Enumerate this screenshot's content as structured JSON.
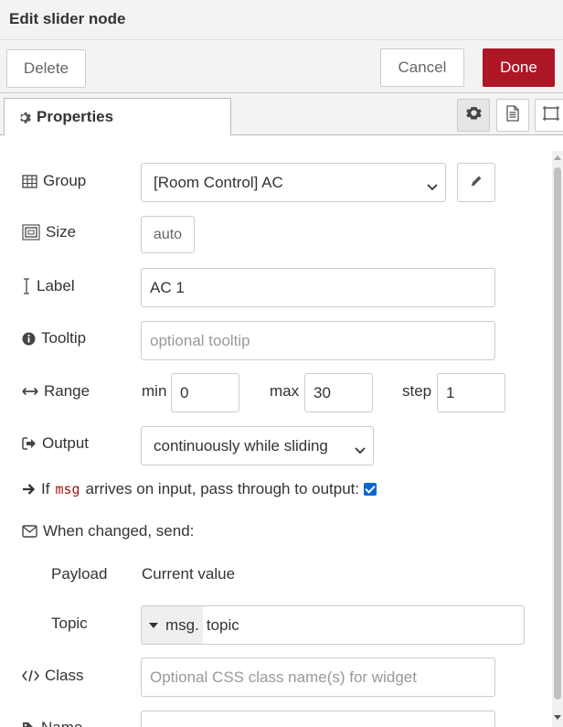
{
  "dialog": {
    "title": "Edit slider node"
  },
  "toolbar": {
    "delete_label": "Delete",
    "cancel_label": "Cancel",
    "done_label": "Done"
  },
  "tabs": {
    "properties_label": "Properties"
  },
  "form": {
    "group": {
      "label": "Group",
      "value": "[Room Control] AC"
    },
    "size": {
      "label": "Size",
      "value": "auto"
    },
    "label_field": {
      "label": "Label",
      "value": "AC 1"
    },
    "tooltip": {
      "label": "Tooltip",
      "placeholder": "optional tooltip"
    },
    "range": {
      "label": "Range",
      "min_label": "min",
      "min_value": "0",
      "max_label": "max",
      "max_value": "30",
      "step_label": "step",
      "step_value": "1"
    },
    "output": {
      "label": "Output",
      "value": "continuously while sliding"
    },
    "passthrough": {
      "prefix": "If",
      "code": "msg",
      "suffix": "arrives on input, pass through to output:",
      "checked": true
    },
    "when_changed": {
      "label": "When changed, send:"
    },
    "payload": {
      "label": "Payload",
      "value": "Current value"
    },
    "topic": {
      "label": "Topic",
      "type": "msg.",
      "value": "topic"
    },
    "class_field": {
      "label": "Class",
      "placeholder": "Optional CSS class name(s) for widget"
    },
    "name": {
      "label": "Name"
    }
  },
  "colors": {
    "done_button": "#ad1625",
    "checkbox": "#0a66d6",
    "code": "#a31515"
  },
  "icons": [
    "gear-icon",
    "document-icon",
    "frame-icon",
    "table-icon",
    "resize-icon",
    "text-cursor-icon",
    "info-circle-icon",
    "arrows-h-icon",
    "sign-out-icon",
    "arrow-right-icon",
    "envelope-icon",
    "code-icon",
    "pencil-icon",
    "tag-icon"
  ]
}
